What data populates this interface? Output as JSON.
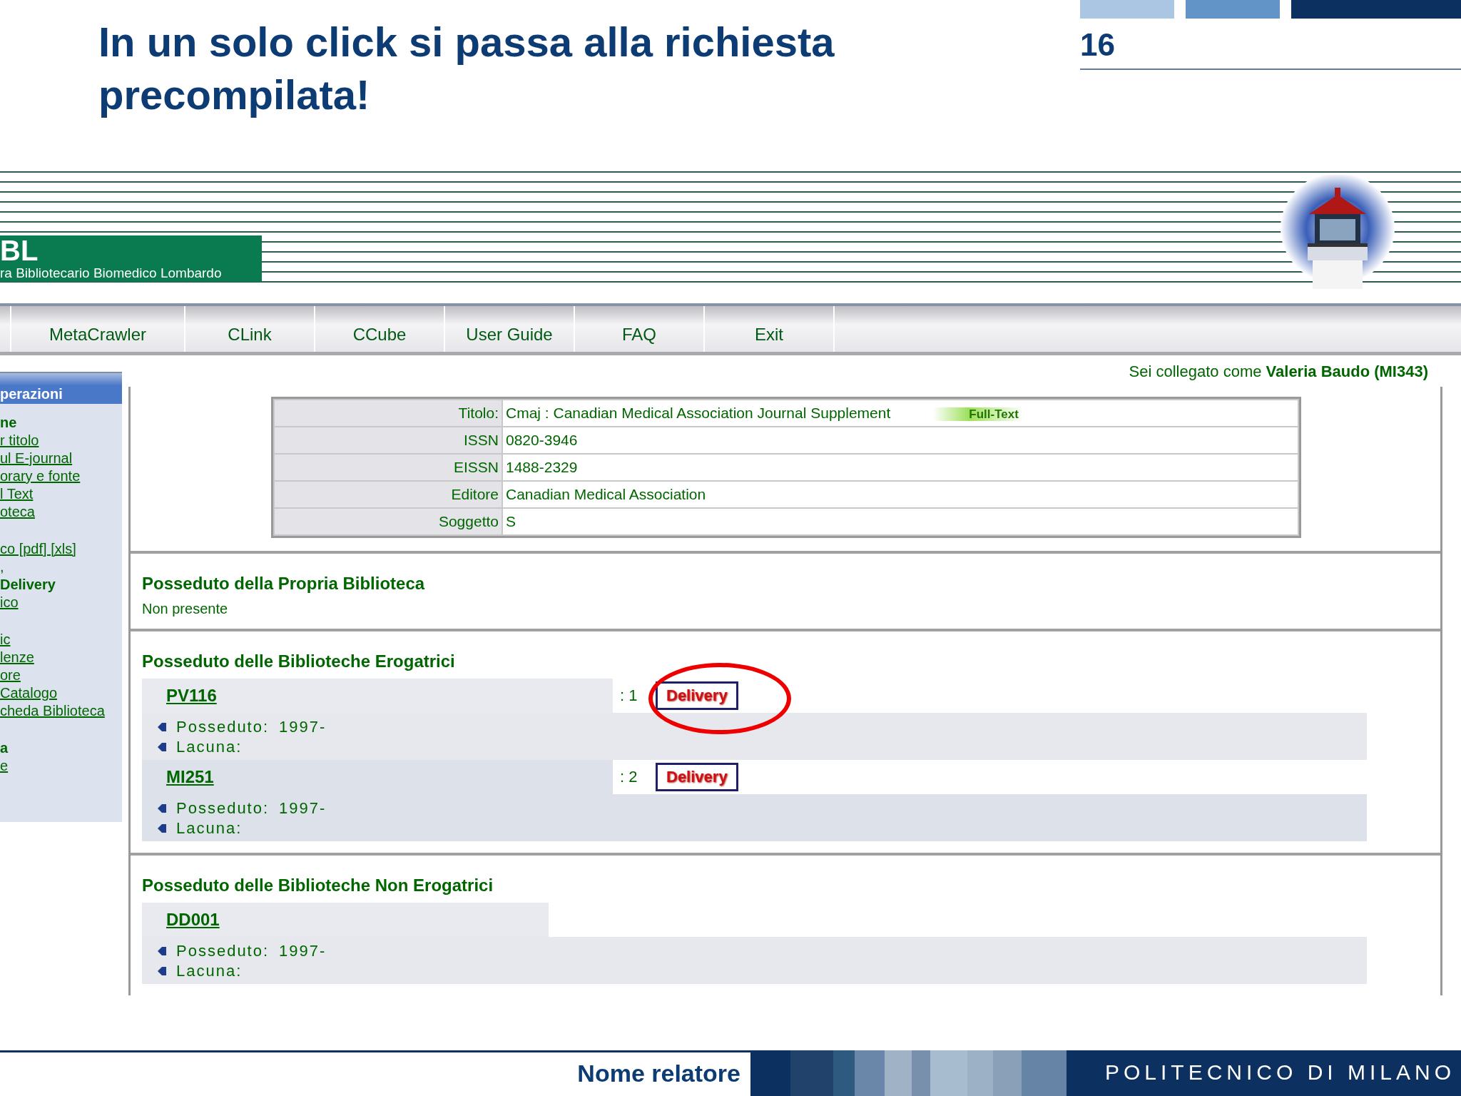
{
  "slide": {
    "title": "In un solo click si passa alla richiesta precompilata!",
    "page_number": "16",
    "speaker": "Nome relatore",
    "institution": "POLITECNICO DI MILANO"
  },
  "site": {
    "logo_mark": "BL",
    "logo_subtitle": "ra Bibliotecario Biomedico Lombardo"
  },
  "nav_tabs": [
    {
      "label": "MetaCrawler"
    },
    {
      "label": "CLink"
    },
    {
      "label": "CCube"
    },
    {
      "label": "User Guide"
    },
    {
      "label": "FAQ"
    },
    {
      "label": "Exit"
    }
  ],
  "login": {
    "prefix": "Sei collegato come",
    "user": "Valeria Baudo (MI343)"
  },
  "sidebar": {
    "header": "perazioni",
    "groups": [
      {
        "items": [
          {
            "label": "ne",
            "kind": "heading"
          },
          {
            "label": "r titolo",
            "kind": "link"
          },
          {
            "label": "ul E-journal",
            "kind": "link"
          },
          {
            "label": "orary e fonte",
            "kind": "link"
          },
          {
            "label": "l Text",
            "kind": "link"
          },
          {
            "label": "oteca",
            "kind": "link"
          }
        ]
      },
      {
        "items": [
          {
            "label": "co [pdf] [xls]",
            "kind": "link"
          },
          {
            "label": ",",
            "kind": "text"
          },
          {
            "label": "Delivery",
            "kind": "heading"
          },
          {
            "label": "ico",
            "kind": "link"
          }
        ]
      },
      {
        "items": [
          {
            "label": "ic",
            "kind": "link"
          },
          {
            "label": "lenze",
            "kind": "link"
          },
          {
            "label": "ore",
            "kind": "link"
          },
          {
            "label": "Catalogo",
            "kind": "link"
          },
          {
            "label": "cheda Biblioteca",
            "kind": "link"
          }
        ]
      },
      {
        "items": [
          {
            "label": "a",
            "kind": "heading"
          },
          {
            "label": "e",
            "kind": "link"
          }
        ]
      }
    ]
  },
  "journal": [
    {
      "label": "Titolo:",
      "value": "Cmaj : Canadian Medical Association Journal Supplement",
      "badge": "Full-Text"
    },
    {
      "label": "ISSN",
      "value": "0820-3946"
    },
    {
      "label": "EISSN",
      "value": "1488-2329"
    },
    {
      "label": "Editore",
      "value": "Canadian Medical Association"
    },
    {
      "label": "Soggetto",
      "value": "S"
    }
  ],
  "own_library": {
    "title": "Posseduto della Propria Biblioteca",
    "note": "Non presente"
  },
  "lending_libraries": {
    "title": "Posseduto delle Biblioteche Erogatrici",
    "libraries": [
      {
        "code": "PV116",
        "rank": ": 1",
        "action": "Delivery",
        "highlighted": true,
        "holdings": [
          {
            "label": "Posseduto:",
            "value": "1997-"
          },
          {
            "label": "Lacuna:"
          }
        ]
      },
      {
        "code": "MI251",
        "rank": ": 2",
        "action": "Delivery",
        "highlighted": false,
        "holdings": [
          {
            "label": "Posseduto:",
            "value": "1997-"
          },
          {
            "label": "Lacuna:"
          }
        ]
      }
    ]
  },
  "other_libraries": {
    "title": "Posseduto delle Biblioteche Non Erogatrici",
    "libraries": [
      {
        "code": "DD001",
        "holdings": [
          {
            "label": "Posseduto:",
            "value": "1997-"
          },
          {
            "label": "Lacuna:"
          }
        ]
      }
    ]
  }
}
